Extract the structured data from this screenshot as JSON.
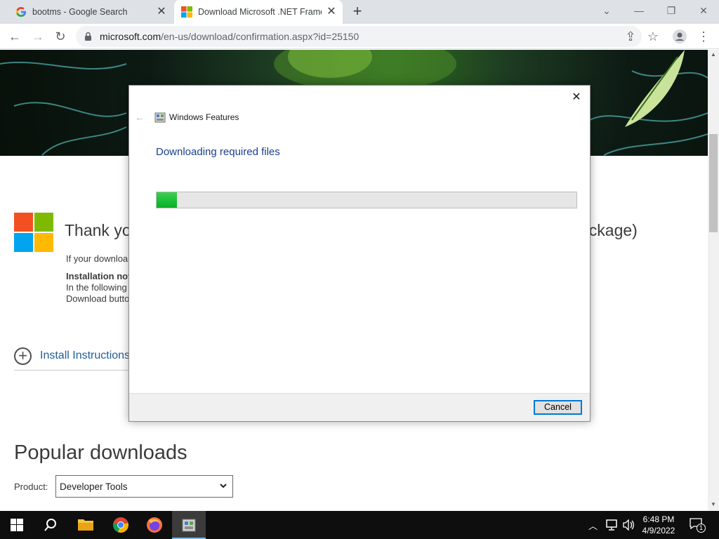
{
  "browser": {
    "tabs": [
      {
        "title": "bootms - Google Search",
        "favicon": "google-g-icon"
      },
      {
        "title": "Download Microsoft .NET Framework",
        "favicon": "microsoft-logo-icon"
      }
    ],
    "url_domain": "microsoft.com",
    "url_path": "/en-us/download/confirmation.aspx?id=25150"
  },
  "page": {
    "thank_text": "Thank you",
    "thank_right": "ackage)",
    "line1": "If your downloa",
    "line2": "Installation note",
    "line3": "In the following",
    "line4": "Download butto",
    "install_link": "Install Instructions",
    "popular_heading": "Popular downloads",
    "product_label": "Product:",
    "product_value": "Developer Tools"
  },
  "dialog": {
    "title": "Windows Features",
    "heading": "Downloading required files",
    "progress": 0.048,
    "cancel_label": "Cancel",
    "progress_color": "#06b025"
  },
  "taskbar": {
    "time": "6:48 PM",
    "date": "4/9/2022",
    "notification_count": "1",
    "pinned": [
      "start-icon",
      "search-icon",
      "file-explorer-icon",
      "chrome-icon",
      "firefox-icon",
      "windows-features-icon"
    ]
  },
  "colors": {
    "ms_red": "#f25022",
    "ms_green": "#7fba00",
    "ms_blue": "#00a4ef",
    "ms_yellow": "#ffb900",
    "link_blue": "#1f5e9a"
  }
}
